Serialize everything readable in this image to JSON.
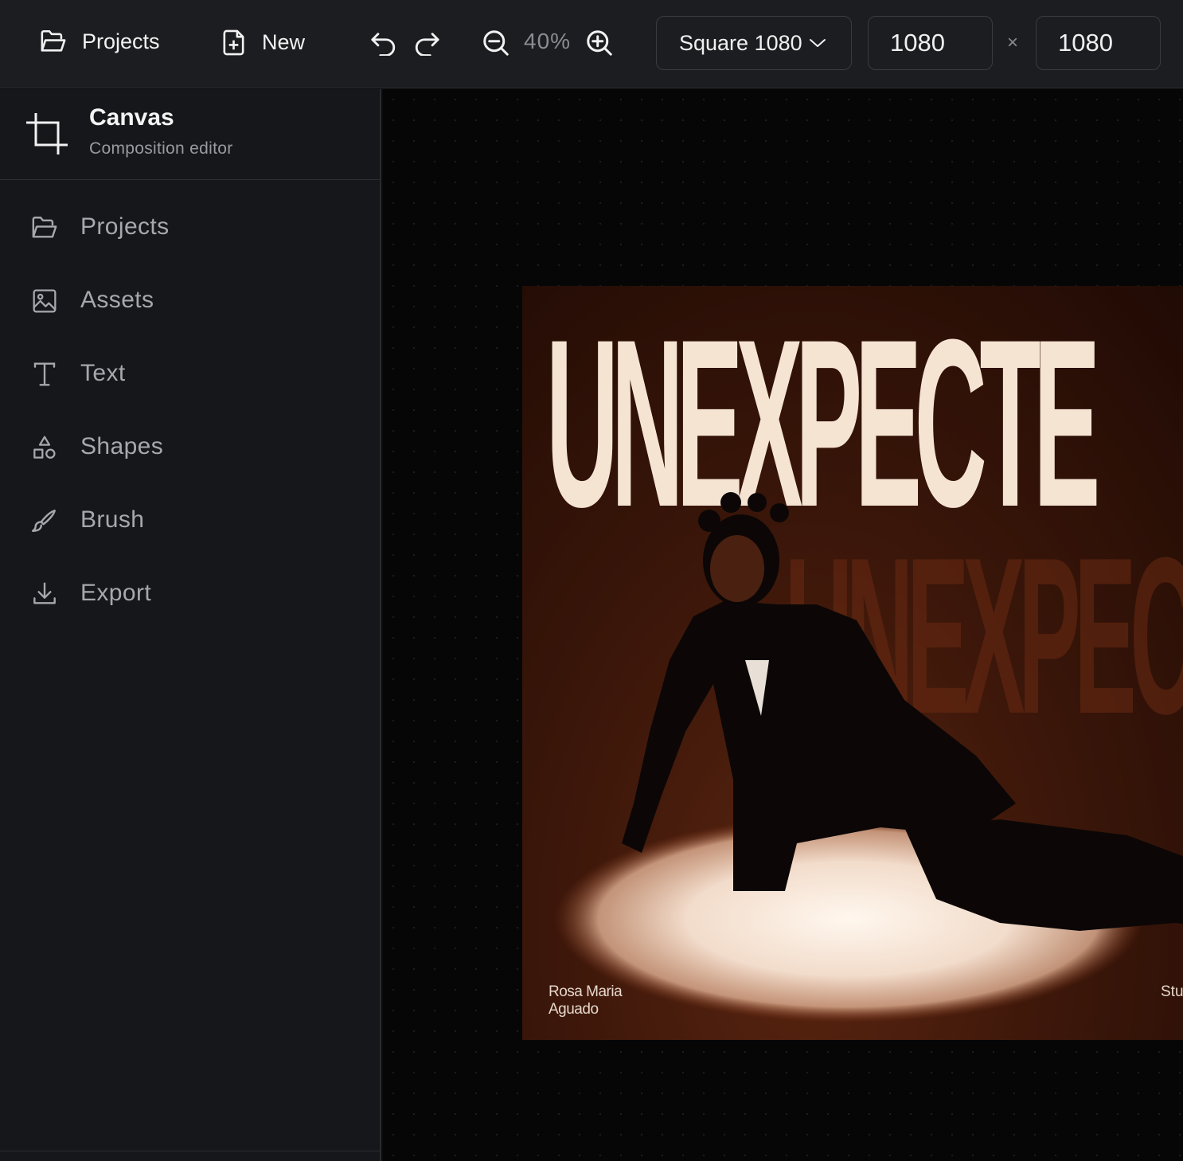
{
  "toolbar": {
    "projects_label": "Projects",
    "new_label": "New",
    "zoom_level": "40%",
    "preset_label": "Square 1080",
    "width_value": "1080",
    "height_value": "1080",
    "times_symbol": "×"
  },
  "sidebar": {
    "title": "Canvas",
    "subtitle": "Composition editor",
    "items": [
      {
        "label": "Projects",
        "icon": "folder-icon"
      },
      {
        "label": "Assets",
        "icon": "image-icon"
      },
      {
        "label": "Text",
        "icon": "text-icon"
      },
      {
        "label": "Shapes",
        "icon": "shapes-icon"
      },
      {
        "label": "Brush",
        "icon": "brush-icon"
      },
      {
        "label": "Export",
        "icon": "download-icon"
      }
    ]
  },
  "artboard": {
    "headline": "UNEXPECTE",
    "credit_line1": "Rosa Maria",
    "credit_line2": "Aguado",
    "credit_right": "Stu"
  },
  "colors": {
    "topbar_bg": "#1c1d20",
    "sidebar_bg": "#16171a",
    "canvas_bg": "#060607",
    "headline": "#f6e4d3",
    "poster_bg": "#3d170a"
  }
}
